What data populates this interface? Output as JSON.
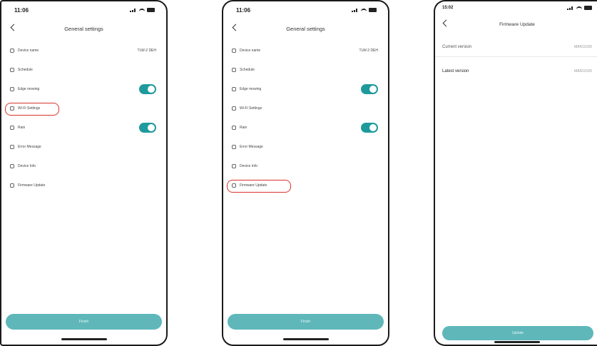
{
  "colors": {
    "accent": "#1e9a9c",
    "button": "#5fb7ba",
    "highlight": "#d9342b"
  },
  "screen1": {
    "status": {
      "time": "11:06"
    },
    "title": "General settings",
    "rows": [
      {
        "icon": "device-icon",
        "label": "Device name",
        "value": "TLW-2 DEH"
      },
      {
        "icon": "schedule-icon",
        "label": "Schedule"
      },
      {
        "icon": "edge-icon",
        "label": "Edge mowing",
        "toggle": true
      },
      {
        "icon": "wifi-icon",
        "label": "Wi-Fi Settings"
      },
      {
        "icon": "rain-icon",
        "label": "Rain",
        "toggle": true
      },
      {
        "icon": "error-icon",
        "label": "Error Message"
      },
      {
        "icon": "info-icon",
        "label": "Device Info"
      },
      {
        "icon": "firmware-icon",
        "label": "Firmware Update"
      }
    ],
    "button_label": "Finish"
  },
  "screen2": {
    "status": {
      "time": "11:06"
    },
    "title": "General settings",
    "rows": [
      {
        "icon": "device-icon",
        "label": "Device name",
        "value": "TLW-2 DEH"
      },
      {
        "icon": "schedule-icon",
        "label": "Schedule"
      },
      {
        "icon": "edge-icon",
        "label": "Edge mowing",
        "toggle": true
      },
      {
        "icon": "wifi-icon",
        "label": "Wi-Fi Settings"
      },
      {
        "icon": "rain-icon",
        "label": "Rain",
        "toggle": true
      },
      {
        "icon": "error-icon",
        "label": "Error Message"
      },
      {
        "icon": "info-icon",
        "label": "Device Info"
      },
      {
        "icon": "firmware-icon",
        "label": "Firmware Update"
      }
    ],
    "button_label": "Finish"
  },
  "screen3": {
    "status": {
      "time": "15:02"
    },
    "title": "Firmware Update",
    "current_label": "Current version",
    "current_value": "MAR10105",
    "latest_label": "Latest version",
    "latest_value": "MAR10105",
    "button_label": "Update"
  }
}
